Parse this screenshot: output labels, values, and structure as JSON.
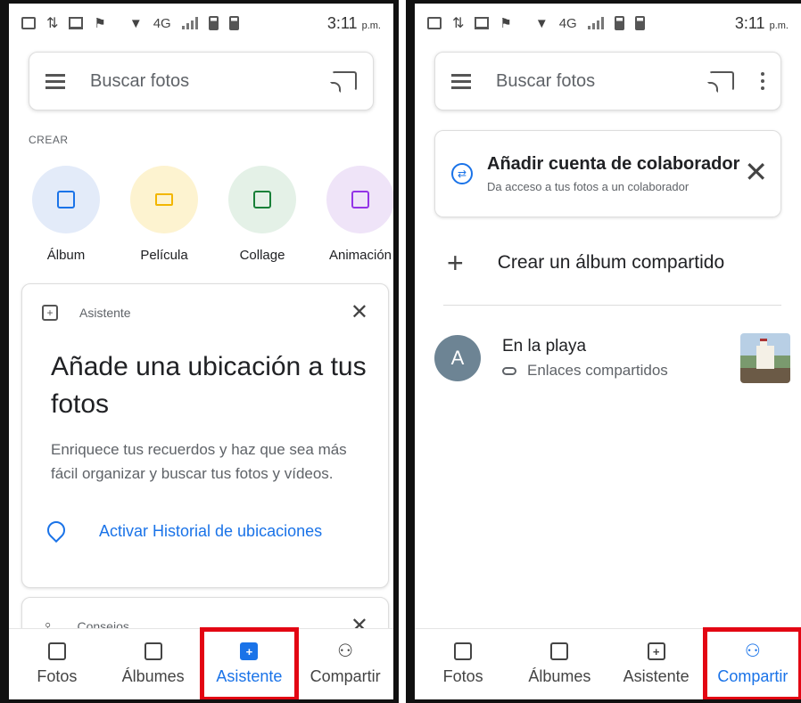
{
  "status_bar": {
    "network": "4G",
    "time": "3:11",
    "ampm": "p.m."
  },
  "left": {
    "search_placeholder": "Buscar fotos",
    "section_create": "CREAR",
    "create_items": [
      {
        "label": "Álbum",
        "icon": "album-icon",
        "bg": "#e3ebf9",
        "fg": "#1a73e8"
      },
      {
        "label": "Película",
        "icon": "movie-icon",
        "bg": "#fdf3d0",
        "fg": "#f2b600"
      },
      {
        "label": "Collage",
        "icon": "collage-icon",
        "bg": "#e4f1e7",
        "fg": "#188038"
      },
      {
        "label": "Animación",
        "icon": "animation-icon",
        "bg": "#efe4f8",
        "fg": "#9334e6"
      }
    ],
    "assistant_card": {
      "tag": "Asistente",
      "title": "Añade una ubicación a tus fotos",
      "body": "Enriquece tus recuerdos y haz que sea más fácil organizar y buscar tus fotos y vídeos.",
      "action": "Activar Historial de ubicaciones"
    },
    "tips_card": {
      "tag": "Consejos"
    }
  },
  "right": {
    "search_placeholder": "Buscar fotos",
    "collab_card": {
      "title": "Añadir cuenta de colaborador",
      "subtitle": "Da acceso a tus fotos a un colaborador"
    },
    "create_shared": "Crear un álbum compartido",
    "album": {
      "avatar_letter": "A",
      "title": "En la playa",
      "subtitle": "Enlaces compartidos"
    }
  },
  "nav": [
    "Fotos",
    "Álbumes",
    "Asistente",
    "Compartir"
  ],
  "colors": {
    "accent": "#1a73e8",
    "highlight": "#e30613"
  }
}
